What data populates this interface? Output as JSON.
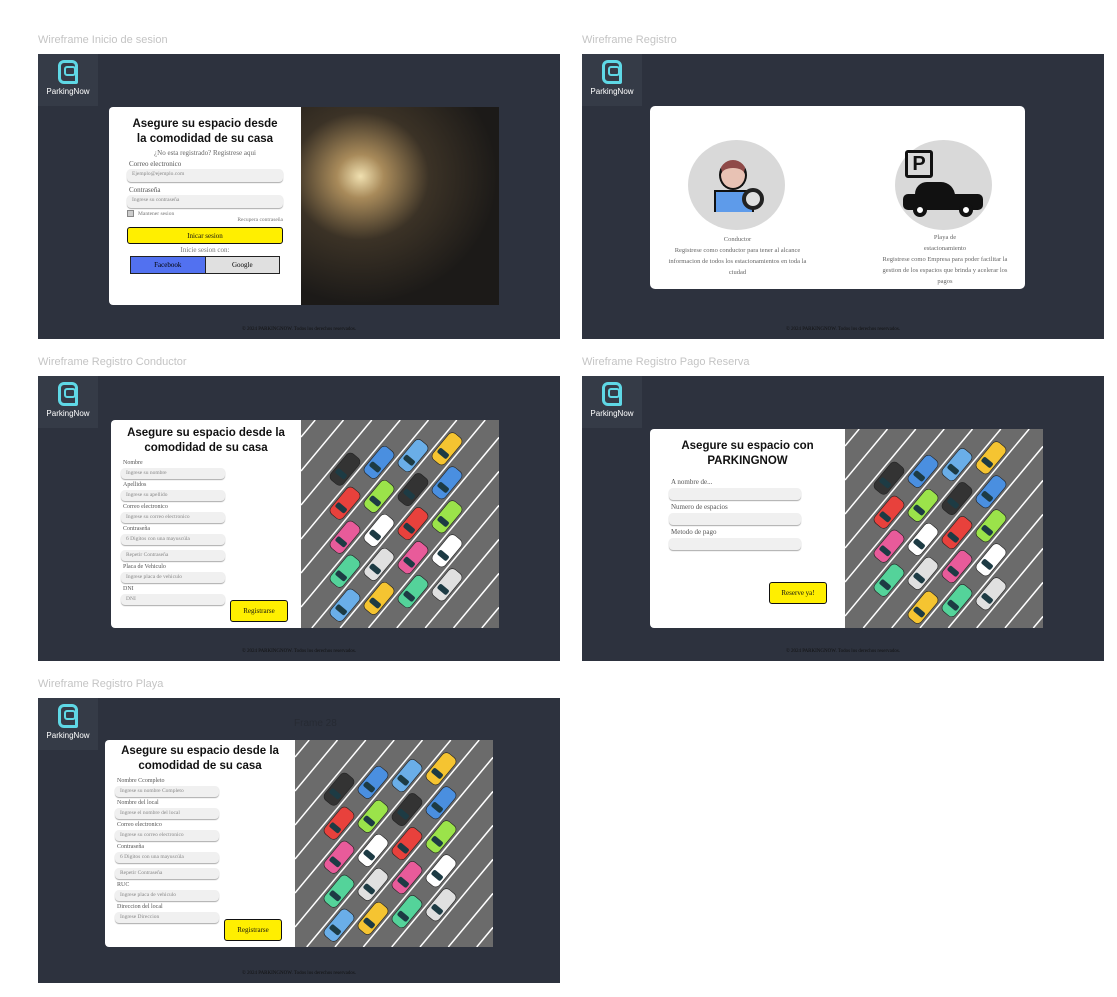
{
  "brand": "ParkingNow",
  "footer": "© 2024 PARKINGNOW. Todos los derechos reservados.",
  "frames": {
    "login": {
      "label": "Wireframe Inicio de sesion",
      "title": "Asegure su espacio desde la comodidad de su casa",
      "register_link": "¿No esta registrado? Registrese aqui",
      "email_label": "Correo electronico",
      "email_placeholder": "Ejemplo@ejemplo.com",
      "password_label": "Contraseña",
      "password_placeholder": "Ingrese su contraseña",
      "remember": "Mantener sesion",
      "recover": "Recupera contraseña",
      "submit": "Inicar sesion",
      "social_label": "Inicie sesion con:",
      "facebook": "Facebook",
      "google": "Google"
    },
    "register": {
      "label": "Wireframe Registro",
      "driver_title": "Conductor",
      "driver_desc": "Registrese como conductor para tener al alcance informacion de todos los estacionamientos en toda la ciudad",
      "lot_title": "Playa de estacionamiento",
      "lot_desc": "Registrese como Empresa para poder facilitar la gestion de los espacios que brinda y acelerar los pagos"
    },
    "driver": {
      "label": "Wireframe Registro Conductor",
      "title": "Asegure su espacio desde la comodidad de su casa",
      "fields": [
        {
          "label": "Nombre",
          "placeholder": "Ingrese su nombre"
        },
        {
          "label": "Apellidos",
          "placeholder": "Ingrese su apellido"
        },
        {
          "label": "Correo electronico",
          "placeholder": "Ingrese su correo electronico"
        },
        {
          "label": "Contraseña",
          "placeholder": "6 Digitos con una mayuscúla"
        },
        {
          "label": "",
          "placeholder": "Repetir Contraseña"
        },
        {
          "label": "Placa de Vehiculo",
          "placeholder": "Ingrese placa de vehiculo"
        },
        {
          "label": "DNI",
          "placeholder": "DNI"
        }
      ],
      "submit": "Registrarse"
    },
    "payment": {
      "label": "Wireframe Registro Pago Reserva",
      "title": "Asegure su espacio con PARKINGNOW",
      "fields": [
        {
          "label": "A nombre de..."
        },
        {
          "label": "Numero de espacios"
        },
        {
          "label": "Metodo de pago"
        }
      ],
      "submit": "Reserve ya!"
    },
    "lot": {
      "label": "Wireframe Registro Playa",
      "frame_name": "Frame 28",
      "title": "Asegure su espacio desde la comodidad de su casa",
      "fields": [
        {
          "label": "Nombre Ccompleto",
          "placeholder": "Ingrese su nombre Completo"
        },
        {
          "label": "Nombre del local",
          "placeholder": "Ingrese el nombre del local"
        },
        {
          "label": "Correo electronico",
          "placeholder": "Ingrese su correo electronico"
        },
        {
          "label": "Contraseña",
          "placeholder": "6 Digitos con una mayuscúla"
        },
        {
          "label": "",
          "placeholder": "Repetir Contraseña"
        },
        {
          "label": "RUC",
          "placeholder": "Ingrese placa de vehiculo"
        },
        {
          "label": "Direccion del local",
          "placeholder": "Ingrese Direccion"
        }
      ],
      "submit": "Registrarse"
    }
  },
  "colors": {
    "frame_bg": "#2d323e",
    "accent_yellow": "#ffef00",
    "facebook": "#5271f0",
    "logo": "#5fd8e6"
  }
}
